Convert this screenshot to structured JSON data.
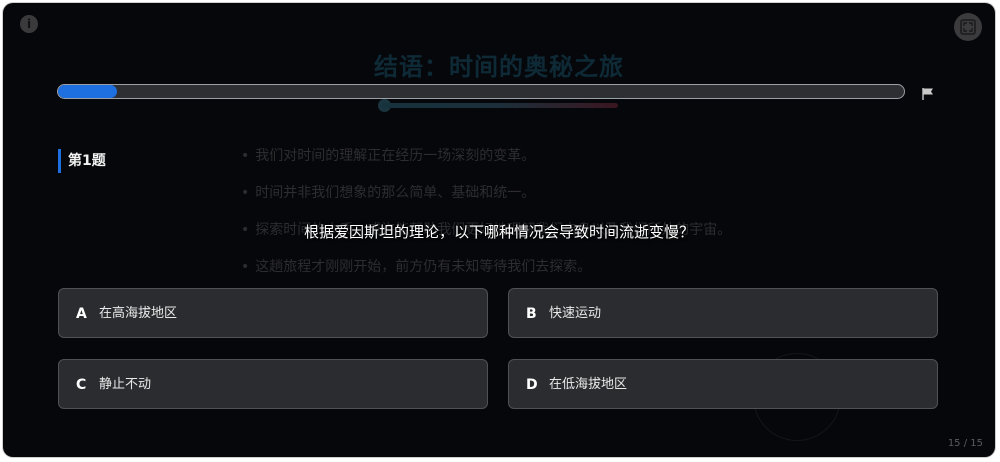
{
  "background_slide": {
    "title": "结语：时间的奥秘之旅",
    "bullets": [
      "我们对时间的理解正在经历一场深刻的变革。",
      "时间并非我们想象的那么简单、基础和统一。",
      "探索时间的本质，或许能帮助我们更好地理解我们自身以及我们所处的宇宙。",
      "这趟旅程才刚刚开始，前方仍有未知等待我们去探索。"
    ]
  },
  "quiz": {
    "progress_fraction": 0.07,
    "question_number": "第1题",
    "question": "根据爱因斯坦的理论，以下哪种情况会导致时间流逝变慢？",
    "options": [
      {
        "letter": "A",
        "label": "在高海拔地区"
      },
      {
        "letter": "B",
        "label": "快速运动"
      },
      {
        "letter": "C",
        "label": "静止不动"
      },
      {
        "letter": "D",
        "label": "在低海拔地区"
      }
    ]
  },
  "footer": {
    "page_counter": "15 / 15"
  },
  "icons": {
    "info": "info-icon",
    "expand": "expand-icon",
    "flag": "flag-icon"
  },
  "colors": {
    "accent": "#1e6fe0",
    "background": "#06070a",
    "option_bg": "#2b2c30"
  }
}
